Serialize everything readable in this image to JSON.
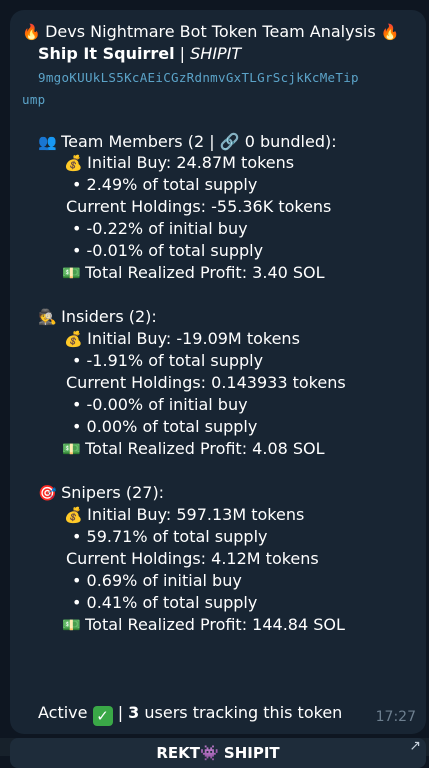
{
  "message": {
    "header": {
      "fire_left": "🔥",
      "title": "Devs Nightmare Bot Token Team Analysis",
      "fire_right": "🔥",
      "token_name": "Ship It Squirrel",
      "separator": "|",
      "token_symbol": "SHIPIT",
      "address_part1": "9mgoKUUkLS5KcAEiCGzRdnmvGxTLGrScjkKcMeTip",
      "address_part2": "ump"
    },
    "team": {
      "icon": "👥",
      "heading": "Team Members (2 | 🔗 0 bundled):",
      "initial_buy_icon": "💰",
      "initial_buy": "Initial Buy: 24.87M tokens",
      "initial_pct": "• 2.49% of total supply",
      "holdings": "Current Holdings: -55.36K tokens",
      "holdings_pct_initial": "• -0.22% of initial buy",
      "holdings_pct_supply": "• -0.01% of total supply",
      "profit_icon": "💵",
      "profit": "Total Realized Profit: 3.40 SOL"
    },
    "insiders": {
      "icon": "🕵",
      "heading": "Insiders (2):",
      "initial_buy_icon": "💰",
      "initial_buy": "Initial Buy: -19.09M tokens",
      "initial_pct": "• -1.91% of total supply",
      "holdings": "Current Holdings: 0.143933 tokens",
      "holdings_pct_initial": "• -0.00% of initial buy",
      "holdings_pct_supply": "• 0.00% of total supply",
      "profit_icon": "💵",
      "profit": "Total Realized Profit: 4.08 SOL"
    },
    "snipers": {
      "icon": "🎯",
      "heading": "Snipers (27):",
      "initial_buy_icon": "💰",
      "initial_buy": "Initial Buy: 597.13M tokens",
      "initial_pct": "• 59.71% of total supply",
      "holdings": "Current Holdings: 4.12M tokens",
      "holdings_pct_initial": "• 0.69% of initial buy",
      "holdings_pct_supply": "• 0.41% of total supply",
      "profit_icon": "💵",
      "profit": "Total Realized Profit: 144.84 SOL"
    },
    "footer": {
      "status": "Active",
      "check": "✓",
      "separator": "|",
      "users_count": "3",
      "users_text": "users tracking this token",
      "time": "17:27"
    }
  },
  "bottom_button": {
    "label": "REKT👾 SHIPIT",
    "arrow": "↗"
  }
}
